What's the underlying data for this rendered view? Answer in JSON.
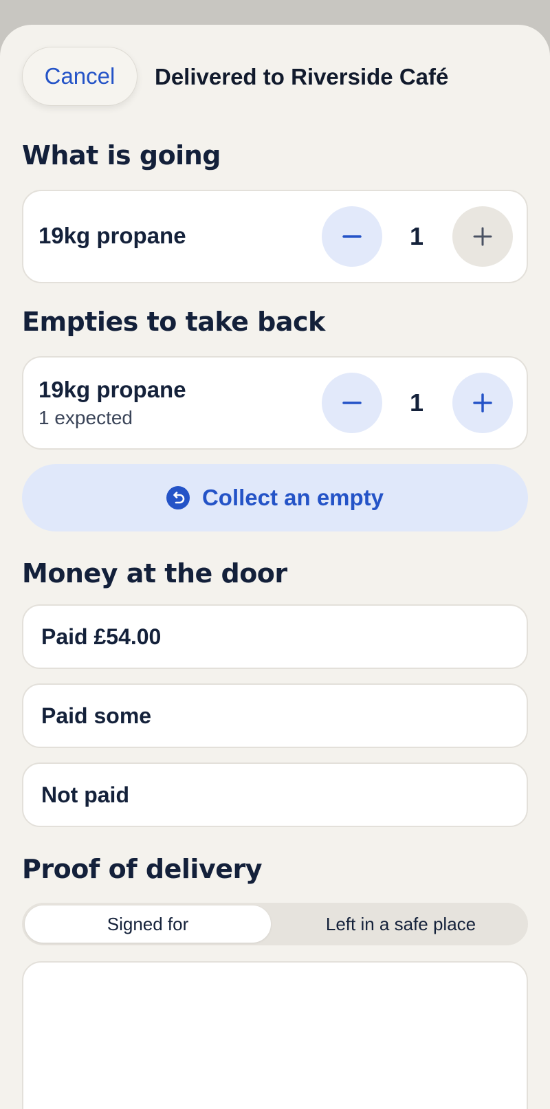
{
  "header": {
    "cancel_label": "Cancel",
    "title": "Delivered to Riverside Café"
  },
  "what_is_going": {
    "heading": "What is going",
    "item": {
      "name": "19kg propane",
      "quantity": "1"
    }
  },
  "empties": {
    "heading": "Empties to take back",
    "item": {
      "name": "19kg propane",
      "subtitle": "1 expected",
      "quantity": "1"
    },
    "collect_button_label": "Collect an empty"
  },
  "money": {
    "heading": "Money at the door",
    "options": [
      "Paid £54.00",
      "Paid some",
      "Not paid"
    ]
  },
  "proof": {
    "heading": "Proof of delivery",
    "segments": [
      "Signed for",
      "Left in a safe place"
    ],
    "selected_segment": "Signed for"
  },
  "colors": {
    "accent": "#2453c7",
    "accent_tint": "#e0e8fa",
    "background": "#f4f2ed",
    "text": "#14213a"
  },
  "icons": {
    "minus": "minus-icon",
    "plus": "plus-icon",
    "collect": "return-arrow-icon"
  }
}
